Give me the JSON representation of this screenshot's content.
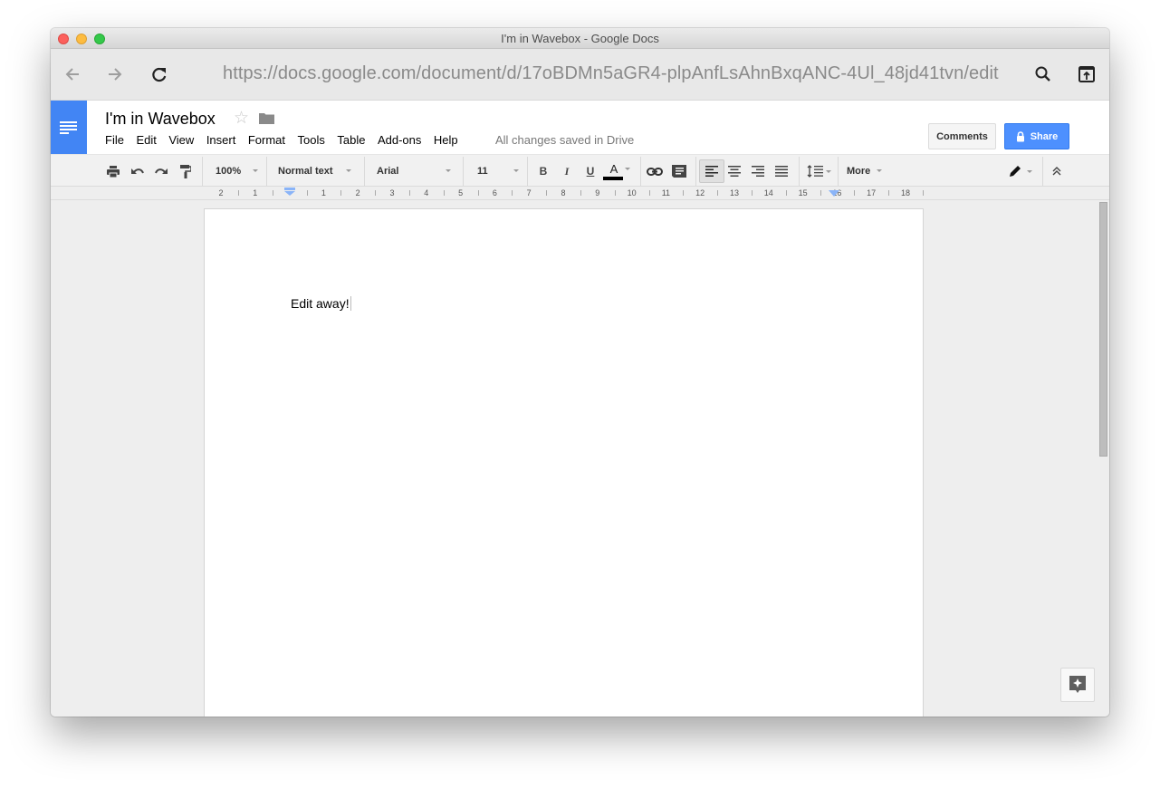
{
  "window": {
    "title": "I'm in Wavebox - Google Docs"
  },
  "browser": {
    "url": "https://docs.google.com/document/d/17oBDMn5aGR4-plpAnfLsAhnBxqANC-4Ul_48jd41tvn/edit",
    "back_icon": "arrow-left-icon",
    "forward_icon": "arrow-right-icon",
    "reload_icon": "reload-icon",
    "search_icon": "search-icon",
    "open_external_icon": "open-in-browser-icon"
  },
  "header": {
    "doc_title": "I'm in Wavebox",
    "menu": [
      "File",
      "Edit",
      "View",
      "Insert",
      "Format",
      "Tools",
      "Table",
      "Add-ons",
      "Help"
    ],
    "save_status": "All changes saved in Drive",
    "comments_label": "Comments",
    "share_label": "Share",
    "brand_color": "#4285f4",
    "share_color": "#4d90fe"
  },
  "toolbar": {
    "zoom": "100%",
    "style": "Normal text",
    "font": "Arial",
    "font_size": "11",
    "bold": "B",
    "italic": "I",
    "underline": "U",
    "text_color": "A",
    "more_label": "More",
    "active_alignment": "left"
  },
  "ruler": {
    "labels": [
      "2",
      "1",
      "",
      "1",
      "2",
      "3",
      "4",
      "5",
      "6",
      "7",
      "8",
      "9",
      "10",
      "11",
      "12",
      "13",
      "14",
      "15",
      "16",
      "17",
      "18"
    ]
  },
  "document": {
    "body_text": "Edit away!"
  }
}
